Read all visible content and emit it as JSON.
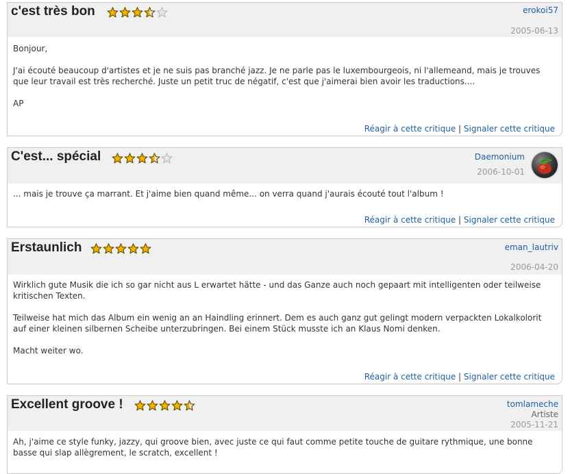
{
  "actions": {
    "react": "Réagir à cette critique",
    "separator": "|",
    "report": "Signaler cette critique"
  },
  "colors": {
    "link": "#2060a0",
    "star_fill": "#f2b300",
    "star_empty": "#e6e6e6"
  },
  "reviews": [
    {
      "title": "c'est très bon",
      "rating": 3.5,
      "user": "erokoi57",
      "date": "2005-06-13",
      "paragraphs": [
        "Bonjour,",
        "J'ai écouté beaucoup d'artistes et je ne suis pas branché jazz. Je ne parle pas le luxembourgeois, ni l'allemeand, mais je trouves que leur travail est très recherché. Juste un petit truc de négatif, c'est que j'aimerai bien avoir les traductions....",
        "AP"
      ]
    },
    {
      "title": "C'est... spécial",
      "rating": 3.5,
      "user": "Daemonium",
      "date": "2006-10-01",
      "avatar": "avatar-image",
      "paragraphs": [
        "... mais je trouve ça marrant. Et j'aime bien quand même... on verra quand j'aurais écouté tout l'album !"
      ]
    },
    {
      "title": "Erstaunlich",
      "rating": 5,
      "user": "eman_lautriv",
      "date": "2006-04-20",
      "paragraphs": [
        "Wirklich gute Musik die ich so gar nicht aus L erwartet hätte - und das Ganze auch noch gepaart mit intelligenten oder teilweise kritischen Texten.",
        "Teilweise hat mich das Album ein wenig an an Haindling erinnert. Dem es auch ganz gut gelingt modern verpackten Lokalkolorit auf einer kleinen silbernen Scheibe unterzubringen. Bei einem Stück musste ich an Klaus Nomi denken.",
        "Macht weiter wo."
      ]
    },
    {
      "title": "Excellent groove !",
      "rating": 4.5,
      "user": "tomlameche",
      "role": "Artiste",
      "date": "2005-11-21",
      "paragraphs": [
        "Ah, j'aime ce style funky, jazzy, qui groove bien, avec juste ce qui faut comme petite touche de guitare rythmique, une bonne basse qui slap allègrement, le scratch, excellent !"
      ]
    }
  ]
}
